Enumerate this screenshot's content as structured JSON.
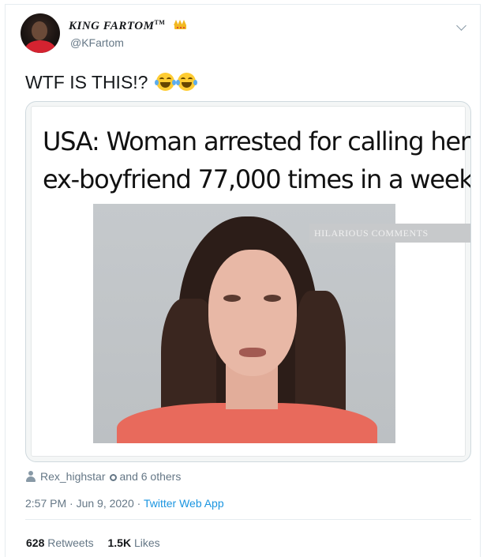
{
  "author": {
    "display_name": "KING FARTOM",
    "trademark": "TM",
    "handle": "@KFartom"
  },
  "tweet": {
    "text": "WTF IS THIS!?"
  },
  "media": {
    "headline_line1": "USA: Woman arrested for calling her",
    "headline_line2": "ex-boyfriend  77,000 times in a week",
    "watermark": "HILARIOUS COMMENTS"
  },
  "social_context": {
    "liker": "Rex_highstar",
    "others": "and 6 others"
  },
  "meta": {
    "time": "2:57 PM · Jun 9, 2020 · ",
    "source": "Twitter Web App"
  },
  "stats": {
    "retweets_count": "628",
    "retweets_label": "Retweets",
    "likes_count": "1.5K",
    "likes_label": "Likes"
  },
  "icons": [
    "avatar",
    "crown-icon",
    "chevron-down-icon",
    "face-with-tears-of-joy-icon",
    "person-icon",
    "gear-icon"
  ]
}
